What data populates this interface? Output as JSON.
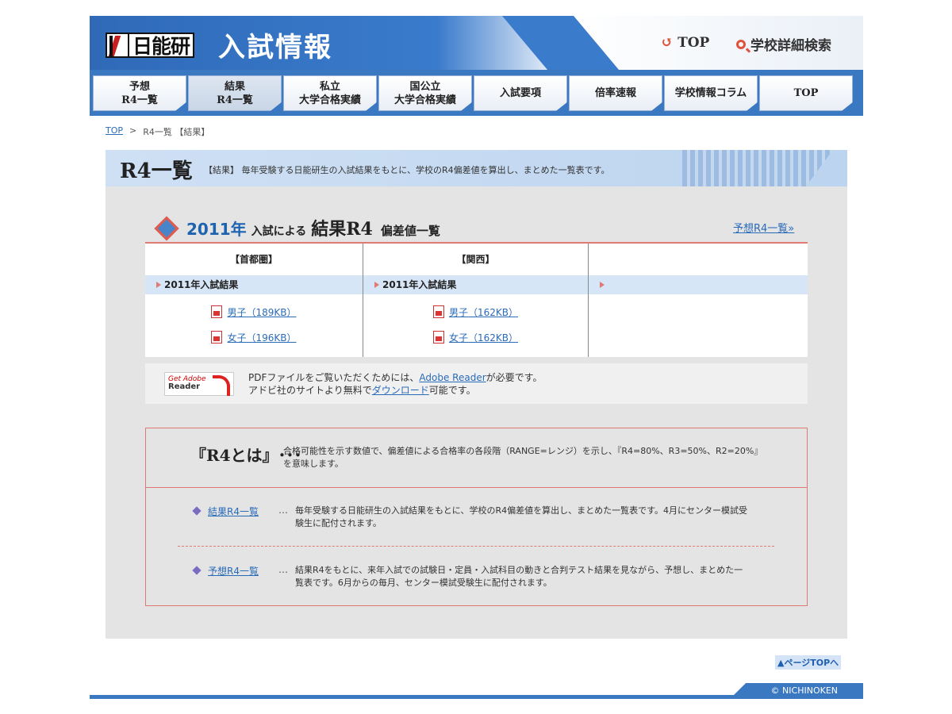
{
  "header": {
    "logo_text": "日能研",
    "title": "入試情報",
    "top_link": "TOP",
    "search_link": "学校詳細検索"
  },
  "nav": [
    {
      "line1": "予想",
      "line2": "R4一覧"
    },
    {
      "line1": "結果",
      "line2": "R4一覧"
    },
    {
      "line1": "私立",
      "line2": "大学合格実績"
    },
    {
      "line1": "国公立",
      "line2": "大学合格実績"
    },
    {
      "line1": "入試要項",
      "line2": ""
    },
    {
      "line1": "倍率速報",
      "line2": ""
    },
    {
      "line1": "学校情報コラム",
      "line2": ""
    },
    {
      "line1": "TOP",
      "line2": ""
    }
  ],
  "breadcrumb": {
    "home": "TOP",
    "sep": ">",
    "current": "R4一覧 【結果】"
  },
  "banner": {
    "title": "R4一覧",
    "desc": "【結果】 毎年受験する日能研生の入試結果をもとに、学校のR4偏差値を算出し、まとめた一覧表です。"
  },
  "heading": {
    "year": "2011年",
    "small1": "入試による",
    "big": "結果R4",
    "small2": "偏差値一覧",
    "link": "予想R4一覧»"
  },
  "table": {
    "columns": [
      {
        "head": "【首都圏】",
        "bar": "2011年入試結果",
        "boys": "男子（189KB）",
        "girls": "女子（196KB）"
      },
      {
        "head": "【関西】",
        "bar": "2011年入試結果",
        "boys": "男子（162KB）",
        "girls": "女子（162KB）"
      }
    ]
  },
  "adobe": {
    "badge_get": "Get Adobe",
    "badge_reader": "Reader",
    "line1_pre": "PDFファイルをご覧いただくためには、",
    "line1_link": "Adobe Reader",
    "line1_post": "が必要です。",
    "line2_pre": "アドビ社のサイトより無料で",
    "line2_link": "ダウンロード",
    "line2_post": "可能です。"
  },
  "info": {
    "r4_title": "『R4とは』･･･",
    "r4_desc": "合格可能性を示す数値で、偏差値による合格率の各段階（RANGE=レンジ）を示し、『R4=80%、R3=50%、R2=20%』を意味します。",
    "items": [
      {
        "link": "結果R4一覧",
        "dots": "…",
        "text": "毎年受験する日能研生の入試結果をもとに、学校のR4偏差値を算出し、まとめた一覧表です。4月にセンター模試受験生に配付されます。"
      },
      {
        "link": "予想R4一覧",
        "dots": "…",
        "text": "結果R4をもとに、来年入試での試験日・定員・入試科目の動きと合判テスト結果を見ながら、予想し、まとめた一覧表です。6月からの毎月、センター模試受験生に配付されます。"
      }
    ]
  },
  "footer": {
    "pagetop": "▲ページTOPへ",
    "copyright": "© NICHINOKEN"
  }
}
